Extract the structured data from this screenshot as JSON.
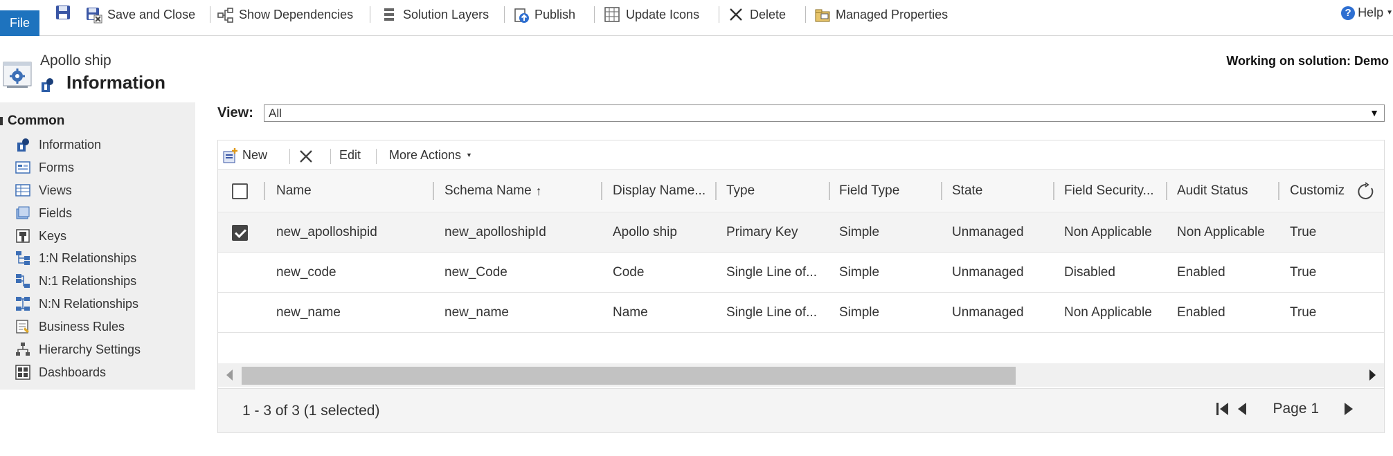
{
  "ribbon": {
    "file": "File",
    "items": [
      {
        "label": "Save and Close"
      },
      {
        "label": "Show Dependencies"
      },
      {
        "label": "Solution Layers"
      },
      {
        "label": "Publish"
      },
      {
        "label": "Update Icons"
      },
      {
        "label": "Delete"
      },
      {
        "label": "Managed Properties"
      }
    ],
    "help": "Help"
  },
  "header": {
    "entity_name": "Apollo ship",
    "page_title": "Information",
    "solution_label": "Working on solution: Demo"
  },
  "nav": {
    "section": "Common",
    "items": [
      {
        "label": "Information",
        "icon": "info-icon"
      },
      {
        "label": "Forms",
        "icon": "form-icon"
      },
      {
        "label": "Views",
        "icon": "views-icon"
      },
      {
        "label": "Fields",
        "icon": "fields-icon"
      },
      {
        "label": "Keys",
        "icon": "key-icon"
      },
      {
        "label": "1:N Relationships",
        "icon": "relationship-icon"
      },
      {
        "label": "N:1 Relationships",
        "icon": "relationship-icon"
      },
      {
        "label": "N:N Relationships",
        "icon": "relationship-icon"
      },
      {
        "label": "Business Rules",
        "icon": "business-rules-icon"
      },
      {
        "label": "Hierarchy Settings",
        "icon": "hierarchy-icon"
      },
      {
        "label": "Dashboards",
        "icon": "dashboard-icon"
      }
    ]
  },
  "view": {
    "label": "View:",
    "selected": "All"
  },
  "grid_toolbar": {
    "new": "New",
    "edit": "Edit",
    "more_actions": "More Actions"
  },
  "grid": {
    "columns": [
      "Name",
      "Schema Name",
      "Display Name...",
      "Type",
      "Field Type",
      "State",
      "Field Security...",
      "Audit Status",
      "Customiz"
    ],
    "rows": [
      {
        "selected": true,
        "cells": [
          "new_apolloshipid",
          "new_apolloshipId",
          "Apollo ship",
          "Primary Key",
          "Simple",
          "Unmanaged",
          "Non Applicable",
          "Non Applicable",
          "True"
        ]
      },
      {
        "selected": false,
        "cells": [
          "new_code",
          "new_Code",
          "Code",
          "Single Line of...",
          "Simple",
          "Unmanaged",
          "Disabled",
          "Enabled",
          "True"
        ]
      },
      {
        "selected": false,
        "cells": [
          "new_name",
          "new_name",
          "Name",
          "Single Line of...",
          "Simple",
          "Unmanaged",
          "Non Applicable",
          "Enabled",
          "True"
        ]
      }
    ],
    "status": "1 - 3 of 3 (1 selected)",
    "page": "Page 1"
  },
  "colors": {
    "file_tab": "#1e73be",
    "nav_bg": "#efefef",
    "selected_row": "#f3f3f3"
  }
}
